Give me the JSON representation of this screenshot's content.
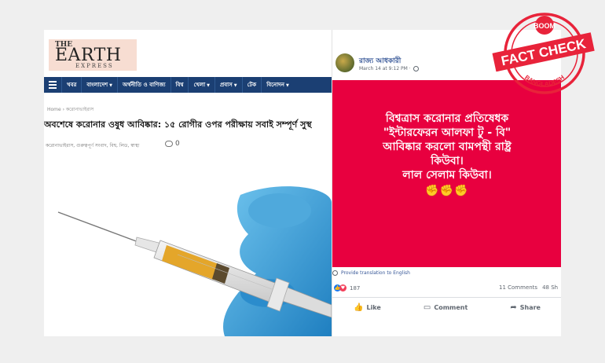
{
  "site": {
    "logo_the": "THE",
    "logo_earth": "EARTH",
    "logo_express": "EXPRESS",
    "nav": [
      "খবর",
      "বাংলাদেশ",
      "অর্থনীতি ও বাণিজ্য",
      "বিশ্ব",
      "খেলা",
      "প্রবাস",
      "টেক",
      "বিনোদন"
    ],
    "breadcrumb": "Home › করোনাভাইরাস",
    "headline": "অবশেষে করোনার ওষুধ আবিষ্কার: ১৫ রোগীর ওপর পরীক্ষায় সবাই সম্পূর্ণ সুস্থ",
    "meta": "করোনাভাইরাস, গুরুত্বপূর্ণ সংবাদ, বিশ্ব, লিড, স্বাস্থ্য",
    "comment_count": "0"
  },
  "post": {
    "author": "রাজ্য আধকারী",
    "time": "March 14 at 9:12 PM ·",
    "lines": [
      "বিশ্বত্রাস করোনার প্রতিষেধক",
      "\"ইন্টারফেরন আলফা টু - বি\"",
      "আবিষ্কার করলো বামপন্থী রাষ্ট্র",
      "কিউবা।",
      "লাল সেলাম কিউবা।"
    ],
    "fists": "✊✊✊",
    "translate": "Provide translation to English",
    "reaction_count": "187",
    "comments": "11 Comments",
    "shares": "48 Sh",
    "actions": {
      "like": "Like",
      "comment": "Comment",
      "share": "Share"
    }
  },
  "stamp": {
    "top": "BOOM",
    "main": "FACT CHECK",
    "bottom": "BANGLADESH",
    "color": "#e8233a"
  }
}
